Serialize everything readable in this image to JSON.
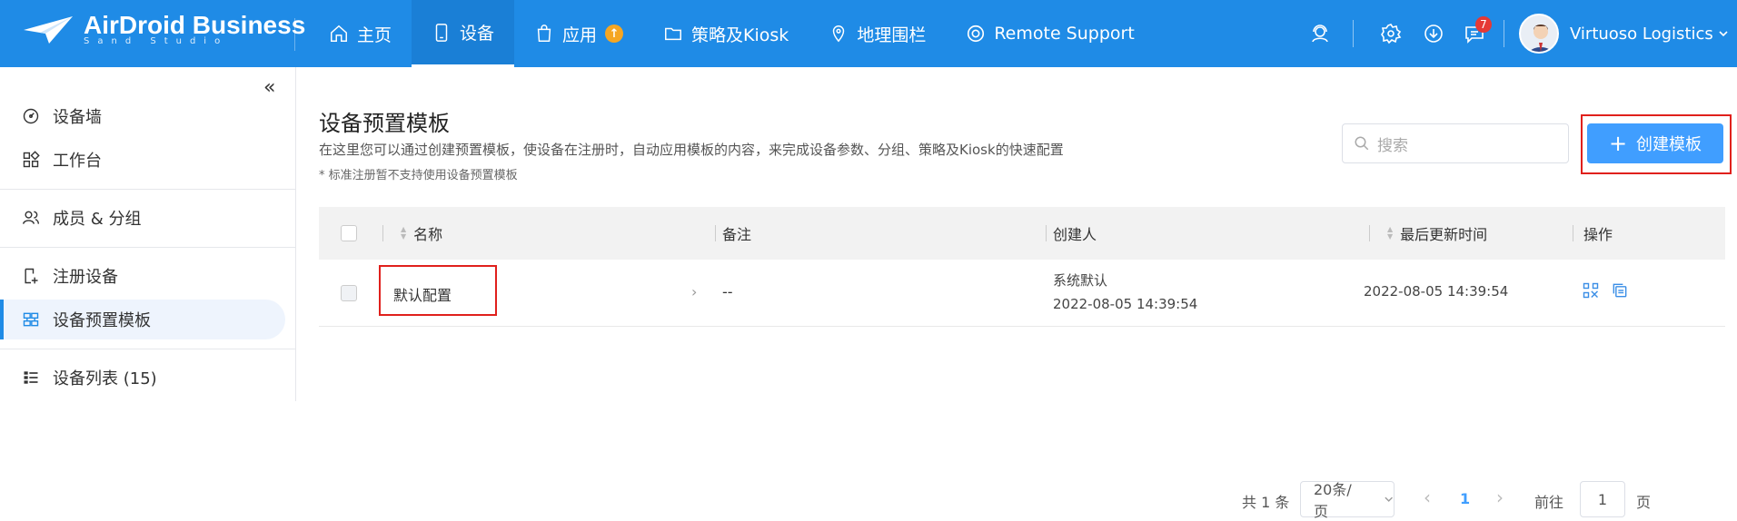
{
  "app": {
    "brand": "AirDroid Business",
    "brand_sub": "Sand Studio",
    "nav": [
      {
        "label": "主页",
        "icon": "home-icon"
      },
      {
        "label": "设备",
        "icon": "device-icon",
        "active": true
      },
      {
        "label": "应用",
        "icon": "app-bag-icon"
      },
      {
        "label": "策略及Kiosk",
        "icon": "folder-icon"
      },
      {
        "label": "地理围栏",
        "icon": "map-pin-icon"
      },
      {
        "label": "Remote Support",
        "icon": "lifebuoy-icon"
      }
    ],
    "notification_count": "7",
    "user_name": "Virtuoso Logistics",
    "accent": "#1f8be6"
  },
  "sidebar": {
    "items": [
      {
        "label": "设备墙",
        "icon": "dashboard-icon"
      },
      {
        "label": "工作台",
        "icon": "grid-icon"
      },
      {
        "label": "成员 & 分组",
        "icon": "users-icon"
      },
      {
        "label": "注册设备",
        "icon": "register-icon"
      },
      {
        "label": "设备预置模板",
        "icon": "template-icon",
        "active": true
      },
      {
        "label": "设备列表 (15)",
        "icon": "list-icon"
      }
    ]
  },
  "page": {
    "title": "设备预置模板",
    "description": "在这里您可以通过创建预置模板，使设备在注册时，自动应用模板的内容，来完成设备参数、分组、策略及Kiosk的快速配置",
    "note": "* 标准注册暂不支持使用设备预置模板",
    "search_placeholder": "搜索",
    "create_label": "创建模板"
  },
  "table": {
    "headers": {
      "name": "名称",
      "remark": "备注",
      "creator": "创建人",
      "updated": "最后更新时间",
      "actions": "操作"
    },
    "rows": [
      {
        "name": "默认配置",
        "remark": "--",
        "creator": "系统默认",
        "created_time": "2022-08-05 14:39:54",
        "updated": "2022-08-05 14:39:54"
      }
    ]
  },
  "pagination": {
    "total": "共 1 条",
    "page_size": "20条/页",
    "current_page": "1",
    "goto_label": "前往",
    "goto_value": "1",
    "page_unit": "页"
  }
}
